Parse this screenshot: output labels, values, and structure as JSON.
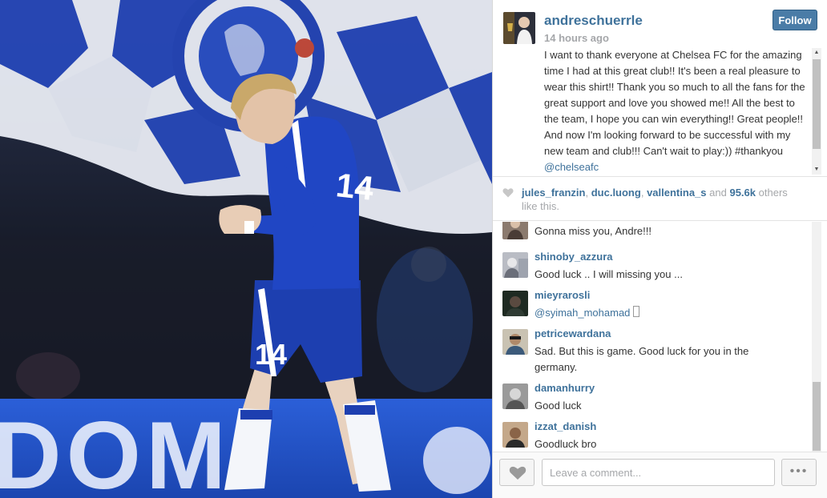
{
  "post": {
    "username": "andreschuerrle",
    "time_ago": "14 hours ago",
    "follow_label": "Follow",
    "caption_text": "I want to thank everyone at Chelsea FC for the amazing time I had at this great club!! It's been a real pleasure to wear this shirt!! Thank you so much to all the fans for the great support and love you showed me!! All the best to the team, I hope you can win everything!! Great people!! And now I'm looking forward to be successful with my new team and club!!! Can't wait to play:)) #thankyou",
    "caption_mention": "@chelseafc"
  },
  "likes": {
    "user1": "jules_franzin",
    "sep1": ",",
    "user2": "duc.luong",
    "sep2": ",",
    "user3": "vallentina_s",
    "and_text": "and",
    "count": "95.6k",
    "suffix": "others like this."
  },
  "comments": [
    {
      "username": "",
      "text": "Gonna miss you, Andre!!!"
    },
    {
      "username": "shinoby_azzura",
      "text": "Good luck .. I will missing you ..."
    },
    {
      "username": "mieyrarosli",
      "mention": "@syimah_mohamad",
      "text": ""
    },
    {
      "username": "petricewardana",
      "text": "Sad. But this is game. Good luck for you in the germany."
    },
    {
      "username": "damanhurry",
      "text": "Good luck"
    },
    {
      "username": "izzat_danish",
      "text": "Goodluck bro"
    }
  ],
  "footer": {
    "comment_placeholder": "Leave a comment...",
    "more_label": "•••"
  },
  "photo": {
    "shirt_number": "14"
  },
  "icons": {
    "like": "heart-icon",
    "more": "ellipsis-icon",
    "scroll_up": "chevron-up-icon",
    "scroll_down": "chevron-down-icon"
  },
  "colors": {
    "link_blue": "#3f729b",
    "follow_button": "#4a7ca7",
    "muted_text": "#a5a7aa",
    "chelsea_blue": "#1d3fb0"
  }
}
